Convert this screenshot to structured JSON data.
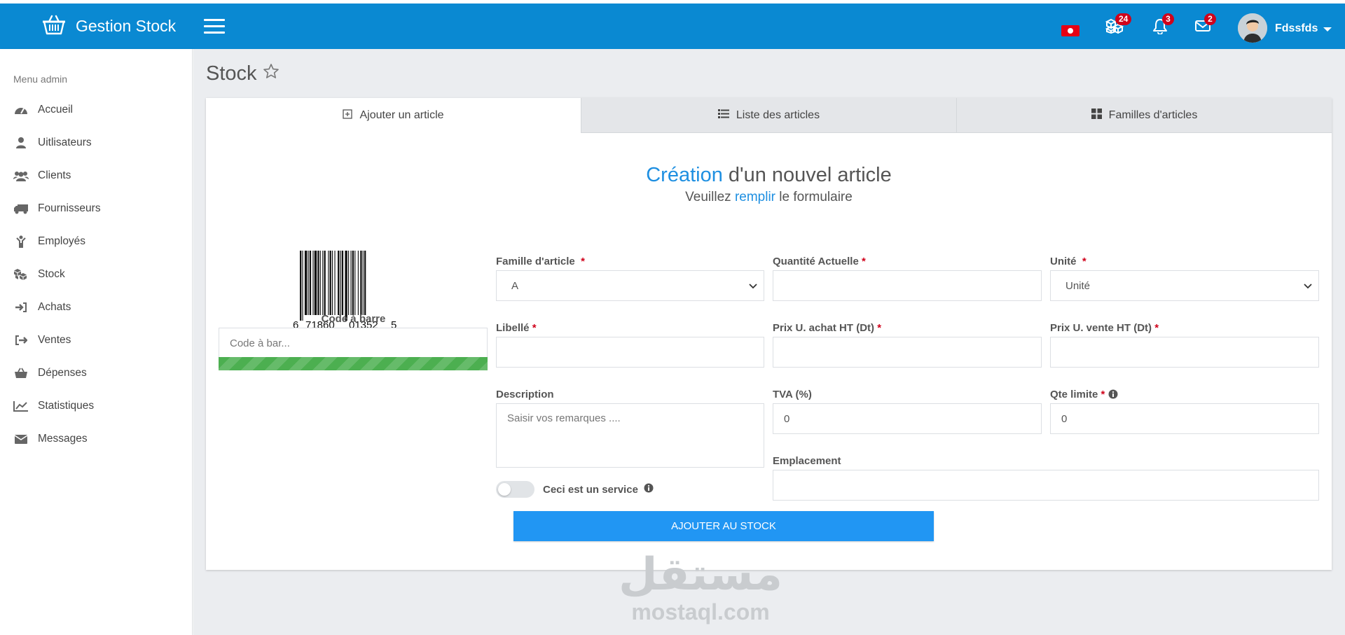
{
  "app": {
    "name": "Gestion Stock"
  },
  "header": {
    "badges": {
      "stock": "24",
      "notifications": "3",
      "messages": "2"
    },
    "user": {
      "name": "Fdssfds"
    }
  },
  "sidebar": {
    "title": "Menu admin",
    "items": [
      {
        "label": "Accueil",
        "icon": "dashboard-icon"
      },
      {
        "label": "Uitlisateurs",
        "icon": "user-icon"
      },
      {
        "label": "Clients",
        "icon": "users-icon"
      },
      {
        "label": "Fournisseurs",
        "icon": "truck-icon"
      },
      {
        "label": "Employés",
        "icon": "child-icon"
      },
      {
        "label": "Stock",
        "icon": "cubes-icon"
      },
      {
        "label": "Achats",
        "icon": "sign-in-icon"
      },
      {
        "label": "Ventes",
        "icon": "sign-out-icon"
      },
      {
        "label": "Dépenses",
        "icon": "basket-icon"
      },
      {
        "label": "Statistiques",
        "icon": "line-chart-icon"
      },
      {
        "label": "Messages",
        "icon": "envelope-icon"
      }
    ]
  },
  "page": {
    "title": "Stock"
  },
  "tabs": [
    {
      "label": "Ajouter un article",
      "icon": "plus-square-icon",
      "active": true
    },
    {
      "label": "Liste des articles",
      "icon": "list-icon",
      "active": false
    },
    {
      "label": "Familles d'articles",
      "icon": "th-large-icon",
      "active": false
    }
  ],
  "form": {
    "heading": {
      "highlight": "Création",
      "rest": "d'un nouvel article"
    },
    "subheading": {
      "pre": "Veuillez",
      "highlight": "remplir",
      "post": "le formulaire"
    },
    "barcode": {
      "digits": [
        "6",
        "71860",
        "01352",
        "5"
      ],
      "label": "Code à barre",
      "placeholder": "Code à bar..."
    },
    "famille": {
      "label": "Famille d'article",
      "value": "A"
    },
    "quantite": {
      "label": "Quantité Actuelle",
      "value": ""
    },
    "unite": {
      "label": "Unité",
      "value": "Unité"
    },
    "libelle": {
      "label": "Libellé",
      "value": ""
    },
    "prix_achat": {
      "label": "Prix U. achat HT (Dt)",
      "value": ""
    },
    "prix_vente": {
      "label": "Prix U. vente HT (Dt)",
      "value": ""
    },
    "description": {
      "label": "Description",
      "placeholder": "Saisir vos remarques ...."
    },
    "tva": {
      "label": "TVA (%)",
      "value": "0"
    },
    "qte_limite": {
      "label": "Qte limite",
      "value": "0"
    },
    "emplacement": {
      "label": "Emplacement",
      "value": ""
    },
    "service_toggle": {
      "label": "Ceci est un service",
      "checked": false
    },
    "submit_label": "AJOUTER AU STOCK",
    "required_mark": "*"
  },
  "watermark": {
    "arabic": "مستقل",
    "latin": "mostaql.com"
  },
  "colors": {
    "primary": "#0a89d2",
    "accent": "#1e8fe1",
    "button": "#2196f3",
    "badge": "#d0021b",
    "progress": "#4caf50"
  }
}
